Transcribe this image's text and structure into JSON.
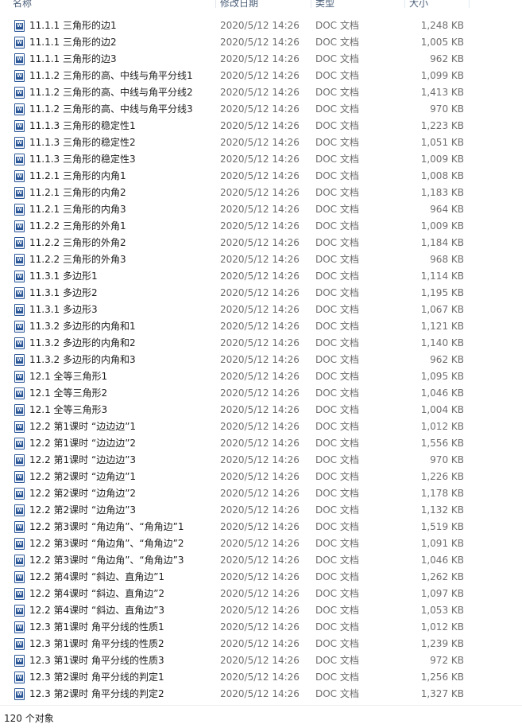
{
  "columns": {
    "name": "名称",
    "date": "修改日期",
    "type": "类型",
    "size": "大小"
  },
  "files": [
    {
      "name": "11.1.1 三角形的边1",
      "date": "2020/5/12 14:26",
      "type": "DOC 文档",
      "size": "1,248 KB"
    },
    {
      "name": "11.1.1 三角形的边2",
      "date": "2020/5/12 14:26",
      "type": "DOC 文档",
      "size": "1,005 KB"
    },
    {
      "name": "11.1.1 三角形的边3",
      "date": "2020/5/12 14:26",
      "type": "DOC 文档",
      "size": "962 KB"
    },
    {
      "name": "11.1.2 三角形的高、中线与角平分线1",
      "date": "2020/5/12 14:26",
      "type": "DOC 文档",
      "size": "1,099 KB"
    },
    {
      "name": "11.1.2 三角形的高、中线与角平分线2",
      "date": "2020/5/12 14:26",
      "type": "DOC 文档",
      "size": "1,413 KB"
    },
    {
      "name": "11.1.2 三角形的高、中线与角平分线3",
      "date": "2020/5/12 14:26",
      "type": "DOC 文档",
      "size": "970 KB"
    },
    {
      "name": "11.1.3 三角形的稳定性1",
      "date": "2020/5/12 14:26",
      "type": "DOC 文档",
      "size": "1,223 KB"
    },
    {
      "name": "11.1.3 三角形的稳定性2",
      "date": "2020/5/12 14:26",
      "type": "DOC 文档",
      "size": "1,051 KB"
    },
    {
      "name": "11.1.3 三角形的稳定性3",
      "date": "2020/5/12 14:26",
      "type": "DOC 文档",
      "size": "1,009 KB"
    },
    {
      "name": "11.2.1 三角形的内角1",
      "date": "2020/5/12 14:26",
      "type": "DOC 文档",
      "size": "1,008 KB"
    },
    {
      "name": "11.2.1 三角形的内角2",
      "date": "2020/5/12 14:26",
      "type": "DOC 文档",
      "size": "1,183 KB"
    },
    {
      "name": "11.2.1 三角形的内角3",
      "date": "2020/5/12 14:26",
      "type": "DOC 文档",
      "size": "964 KB"
    },
    {
      "name": "11.2.2 三角形的外角1",
      "date": "2020/5/12 14:26",
      "type": "DOC 文档",
      "size": "1,009 KB"
    },
    {
      "name": "11.2.2 三角形的外角2",
      "date": "2020/5/12 14:26",
      "type": "DOC 文档",
      "size": "1,184 KB"
    },
    {
      "name": "11.2.2 三角形的外角3",
      "date": "2020/5/12 14:26",
      "type": "DOC 文档",
      "size": "968 KB"
    },
    {
      "name": "11.3.1 多边形1",
      "date": "2020/5/12 14:26",
      "type": "DOC 文档",
      "size": "1,114 KB"
    },
    {
      "name": "11.3.1 多边形2",
      "date": "2020/5/12 14:26",
      "type": "DOC 文档",
      "size": "1,195 KB"
    },
    {
      "name": "11.3.1 多边形3",
      "date": "2020/5/12 14:26",
      "type": "DOC 文档",
      "size": "1,067 KB"
    },
    {
      "name": "11.3.2 多边形的内角和1",
      "date": "2020/5/12 14:26",
      "type": "DOC 文档",
      "size": "1,121 KB"
    },
    {
      "name": "11.3.2 多边形的内角和2",
      "date": "2020/5/12 14:26",
      "type": "DOC 文档",
      "size": "1,140 KB"
    },
    {
      "name": "11.3.2 多边形的内角和3",
      "date": "2020/5/12 14:26",
      "type": "DOC 文档",
      "size": "962 KB"
    },
    {
      "name": "12.1 全等三角形1",
      "date": "2020/5/12 14:26",
      "type": "DOC 文档",
      "size": "1,095 KB"
    },
    {
      "name": "12.1 全等三角形2",
      "date": "2020/5/12 14:26",
      "type": "DOC 文档",
      "size": "1,046 KB"
    },
    {
      "name": "12.1 全等三角形3",
      "date": "2020/5/12 14:26",
      "type": "DOC 文档",
      "size": "1,004 KB"
    },
    {
      "name": "12.2 第1课时 “边边边”1",
      "date": "2020/5/12 14:26",
      "type": "DOC 文档",
      "size": "1,012 KB"
    },
    {
      "name": "12.2 第1课时 “边边边”2",
      "date": "2020/5/12 14:26",
      "type": "DOC 文档",
      "size": "1,556 KB"
    },
    {
      "name": "12.2 第1课时 “边边边”3",
      "date": "2020/5/12 14:26",
      "type": "DOC 文档",
      "size": "970 KB"
    },
    {
      "name": "12.2 第2课时 “边角边”1",
      "date": "2020/5/12 14:26",
      "type": "DOC 文档",
      "size": "1,226 KB"
    },
    {
      "name": "12.2 第2课时 “边角边”2",
      "date": "2020/5/12 14:26",
      "type": "DOC 文档",
      "size": "1,178 KB"
    },
    {
      "name": "12.2 第2课时 “边角边”3",
      "date": "2020/5/12 14:26",
      "type": "DOC 文档",
      "size": "1,132 KB"
    },
    {
      "name": "12.2 第3课时 “角边角”、“角角边”1",
      "date": "2020/5/12 14:26",
      "type": "DOC 文档",
      "size": "1,519 KB"
    },
    {
      "name": "12.2 第3课时 “角边角”、“角角边”2",
      "date": "2020/5/12 14:26",
      "type": "DOC 文档",
      "size": "1,091 KB"
    },
    {
      "name": "12.2 第3课时 “角边角”、“角角边”3",
      "date": "2020/5/12 14:26",
      "type": "DOC 文档",
      "size": "1,046 KB"
    },
    {
      "name": "12.2 第4课时 “斜边、直角边”1",
      "date": "2020/5/12 14:26",
      "type": "DOC 文档",
      "size": "1,262 KB"
    },
    {
      "name": "12.2 第4课时 “斜边、直角边”2",
      "date": "2020/5/12 14:26",
      "type": "DOC 文档",
      "size": "1,097 KB"
    },
    {
      "name": "12.2 第4课时 “斜边、直角边”3",
      "date": "2020/5/12 14:26",
      "type": "DOC 文档",
      "size": "1,053 KB"
    },
    {
      "name": "12.3 第1课时 角平分线的性质1",
      "date": "2020/5/12 14:26",
      "type": "DOC 文档",
      "size": "1,012 KB"
    },
    {
      "name": "12.3 第1课时 角平分线的性质2",
      "date": "2020/5/12 14:26",
      "type": "DOC 文档",
      "size": "1,239 KB"
    },
    {
      "name": "12.3 第1课时 角平分线的性质3",
      "date": "2020/5/12 14:26",
      "type": "DOC 文档",
      "size": "972 KB"
    },
    {
      "name": "12.3 第2课时 角平分线的判定1",
      "date": "2020/5/12 14:26",
      "type": "DOC 文档",
      "size": "1,256 KB"
    },
    {
      "name": "12.3 第2课时 角平分线的判定2",
      "date": "2020/5/12 14:26",
      "type": "DOC 文档",
      "size": "1,327 KB"
    }
  ],
  "status": {
    "count_text": "120 个对象"
  }
}
